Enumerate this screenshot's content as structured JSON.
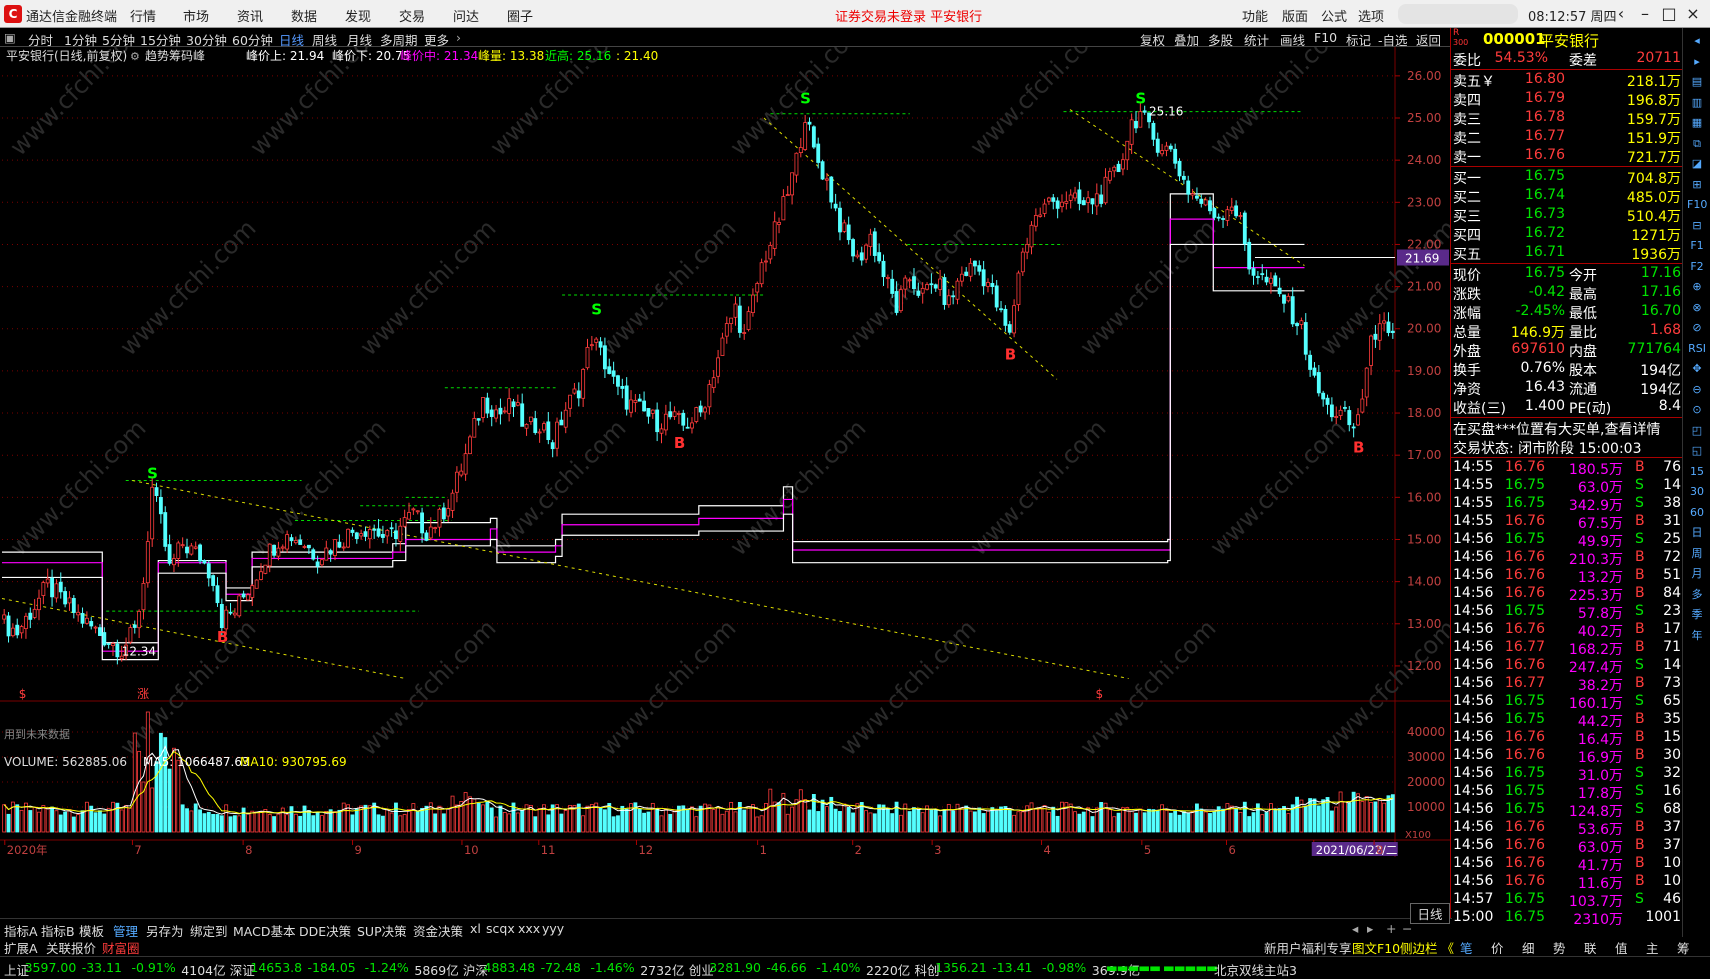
{
  "app": {
    "name": "通达信金融终端",
    "menu": [
      "行情",
      "市场",
      "资讯",
      "数据",
      "发现",
      "交易",
      "问达",
      "圈子"
    ],
    "status_notice": "证券交易未登录 平安银行",
    "right_menu": [
      "功能",
      "版面",
      "公式",
      "选项"
    ],
    "clock": "08:12:57 周四"
  },
  "period_bar": {
    "items": [
      "分时",
      "1分钟",
      "5分钟",
      "15分钟",
      "30分钟",
      "60分钟",
      "日线",
      "周线",
      "月线",
      "多周期",
      "更多"
    ],
    "active": "日线",
    "tools": [
      "复权",
      "叠加",
      "多股",
      "统计",
      "画线",
      "F10",
      "标记",
      "-自选",
      "返回"
    ]
  },
  "chart_header": {
    "title": "平安银行(日线,前复权)",
    "indicator": "趋势筹码峰",
    "items": [
      {
        "label": "峰价上: 21.94",
        "color": "#ffffff"
      },
      {
        "label": "峰价下: 20.75",
        "color": "#ffffff"
      },
      {
        "label": "峰价中: 21.34",
        "color": "#ff00ff"
      },
      {
        "label": "峰量: 13.38",
        "color": "#ffff00"
      },
      {
        "label": "近高: 25.16",
        "color": "#00ff00"
      },
      {
        "label": ": 21.40",
        "color": "#ffff00"
      }
    ]
  },
  "volume_header": {
    "label": "VOLUME: 562885.06",
    "ma5": "MA5: 1066487.63",
    "ma10": "MA10: 930795.69"
  },
  "chart_data": {
    "type": "candlestick",
    "colors": {
      "up": "#ff3c3c",
      "down": "#54ffff",
      "grid": "#7a0000",
      "ma5": "#ffffff",
      "ma10": "#ffff00",
      "peak": "#ff00ff",
      "band": "#ffffff"
    },
    "price_axis": {
      "ylim": [
        11.5,
        26.4
      ],
      "ticks": [
        "26.00",
        "25.00",
        "24.00",
        "23.00",
        "22.00",
        "21.00",
        "20.00",
        "19.00",
        "18.00",
        "17.00",
        "16.00",
        "15.00",
        "14.00",
        "13.00",
        "12.00"
      ]
    },
    "volume_axis": {
      "ylim": [
        0,
        50000
      ],
      "ticks": [
        "40000",
        "30000",
        "20000",
        "10000"
      ],
      "unit": "X100"
    },
    "x_axis": {
      "labels": [
        "2020年",
        "7",
        "8",
        "9",
        "10",
        "11",
        "12",
        "1",
        "2",
        "3",
        "4",
        "5",
        "6",
        "2021/06/22/二",
        "8"
      ]
    },
    "price_label": "21.69",
    "keypoints": [
      [
        0,
        13.0
      ],
      [
        3,
        12.8
      ],
      [
        10,
        13.9
      ],
      [
        14,
        13.5
      ],
      [
        19,
        13.0
      ],
      [
        24,
        12.6
      ],
      [
        27,
        12.4
      ],
      [
        30,
        12.8
      ],
      [
        32,
        14.0
      ],
      [
        34,
        16.2
      ],
      [
        36,
        15.4
      ],
      [
        38,
        14.3
      ],
      [
        41,
        14.9
      ],
      [
        45,
        14.6
      ],
      [
        48,
        14.1
      ],
      [
        50,
        13.1
      ],
      [
        53,
        13.3
      ],
      [
        57,
        14.0
      ],
      [
        60,
        14.6
      ],
      [
        63,
        15.0
      ],
      [
        66,
        15.1
      ],
      [
        69,
        14.9
      ],
      [
        72,
        14.6
      ],
      [
        76,
        14.9
      ],
      [
        80,
        15.2
      ],
      [
        84,
        15.3
      ],
      [
        88,
        15.0
      ],
      [
        91,
        15.3
      ],
      [
        94,
        15.6
      ],
      [
        97,
        15.2
      ],
      [
        100,
        15.5
      ],
      [
        103,
        16.1
      ],
      [
        106,
        17.0
      ],
      [
        110,
        18.3
      ],
      [
        114,
        18.0
      ],
      [
        117,
        18.2
      ],
      [
        120,
        17.6
      ],
      [
        123,
        17.8
      ],
      [
        126,
        17.3
      ],
      [
        129,
        18.1
      ],
      [
        132,
        18.6
      ],
      [
        135,
        19.8
      ],
      [
        138,
        19.2
      ],
      [
        141,
        18.5
      ],
      [
        144,
        18.2
      ],
      [
        147,
        18.0
      ],
      [
        150,
        17.8
      ],
      [
        153,
        17.9
      ],
      [
        156,
        17.7
      ],
      [
        160,
        18.0
      ],
      [
        163,
        19.0
      ],
      [
        166,
        20.0
      ],
      [
        168,
        20.5
      ],
      [
        170,
        19.8
      ],
      [
        174,
        21.5
      ],
      [
        177,
        22.3
      ],
      [
        180,
        23.2
      ],
      [
        182,
        24.0
      ],
      [
        184,
        25.1
      ],
      [
        186,
        24.2
      ],
      [
        189,
        23.5
      ],
      [
        192,
        22.5
      ],
      [
        196,
        21.6
      ],
      [
        199,
        22.2
      ],
      [
        202,
        21.3
      ],
      [
        205,
        20.5
      ],
      [
        208,
        21.2
      ],
      [
        211,
        20.8
      ],
      [
        214,
        21.1
      ],
      [
        217,
        20.6
      ],
      [
        220,
        21.3
      ],
      [
        223,
        21.5
      ],
      [
        226,
        21.1
      ],
      [
        229,
        20.3
      ],
      [
        231,
        19.8
      ],
      [
        233,
        21.4
      ],
      [
        236,
        22.5
      ],
      [
        240,
        23.0
      ],
      [
        244,
        23.1
      ],
      [
        248,
        22.9
      ],
      [
        252,
        23.2
      ],
      [
        256,
        23.8
      ],
      [
        259,
        24.9
      ],
      [
        261,
        25.1
      ],
      [
        264,
        24.5
      ],
      [
        268,
        24.2
      ],
      [
        272,
        23.3
      ],
      [
        276,
        22.9
      ],
      [
        279,
        22.7
      ],
      [
        282,
        23.0
      ],
      [
        284,
        22.5
      ],
      [
        286,
        21.5
      ],
      [
        290,
        21.1
      ],
      [
        294,
        20.7
      ],
      [
        298,
        20.0
      ],
      [
        301,
        18.7
      ],
      [
        304,
        18.1
      ],
      [
        308,
        17.9
      ],
      [
        310,
        17.6
      ],
      [
        312,
        18.4
      ],
      [
        314,
        19.6
      ],
      [
        316,
        20.3
      ],
      [
        318,
        19.7
      ],
      [
        320,
        19.8
      ]
    ],
    "dashed_resistance": [
      {
        "p": 13.3,
        "x1": 0.08,
        "x2": 0.32
      },
      {
        "p": 16.4,
        "x1": 0.095,
        "x2": 0.23
      },
      {
        "p": 15.45,
        "x1": 0.225,
        "x2": 0.345
      },
      {
        "p": 15.8,
        "x1": 0.275,
        "x2": 0.34
      },
      {
        "p": 16.0,
        "x1": 0.31,
        "x2": 0.34
      },
      {
        "p": 18.6,
        "x1": 0.34,
        "x2": 0.425
      },
      {
        "p": 20.8,
        "x1": 0.43,
        "x2": 0.585
      },
      {
        "p": 25.1,
        "x1": 0.59,
        "x2": 0.697
      },
      {
        "p": 22.0,
        "x1": 0.695,
        "x2": 0.815
      },
      {
        "p": 25.15,
        "x1": 0.815,
        "x2": 0.998
      }
    ],
    "trendlines": [
      [
        0.0,
        13.6,
        0.31,
        11.7
      ],
      [
        0.1,
        16.4,
        0.865,
        11.7
      ],
      [
        0.585,
        25.0,
        0.81,
        18.8
      ],
      [
        0.82,
        25.2,
        1.0,
        21.5
      ]
    ],
    "signals": [
      {
        "t": "S",
        "i": 34,
        "p": 16.3
      },
      {
        "t": "S",
        "i": 136,
        "p": 20.2
      },
      {
        "t": "S",
        "i": 184,
        "p": 25.2
      },
      {
        "t": "S",
        "i": 261,
        "p": 25.2
      },
      {
        "t": "B",
        "i": 50,
        "p": 12.9
      },
      {
        "t": "B",
        "i": 155,
        "p": 17.5
      },
      {
        "t": "B",
        "i": 231,
        "p": 19.6
      },
      {
        "t": "B",
        "i": 311,
        "p": 17.4
      }
    ],
    "peak_band": [
      [
        0.0,
        14.7,
        14.45,
        14.1
      ],
      [
        0.075,
        14.7,
        14.45,
        14.1
      ],
      [
        0.077,
        12.55,
        12.35,
        12.15
      ],
      [
        0.118,
        12.55,
        12.35,
        12.15
      ],
      [
        0.12,
        14.5,
        14.45,
        14.2
      ],
      [
        0.17,
        14.5,
        14.45,
        14.2
      ],
      [
        0.172,
        13.85,
        13.7,
        13.55
      ],
      [
        0.19,
        13.85,
        13.7,
        13.55
      ],
      [
        0.192,
        14.7,
        14.55,
        14.35
      ],
      [
        0.3,
        14.9,
        14.7,
        14.5
      ],
      [
        0.31,
        15.4,
        15.0,
        14.85
      ],
      [
        0.375,
        15.5,
        15.25,
        15.0
      ],
      [
        0.38,
        14.85,
        14.7,
        14.45
      ],
      [
        0.425,
        15.0,
        14.85,
        14.6
      ],
      [
        0.43,
        15.6,
        15.35,
        15.1
      ],
      [
        0.535,
        15.8,
        15.5,
        15.2
      ],
      [
        0.6,
        16.25,
        15.95,
        15.6
      ],
      [
        0.607,
        14.95,
        14.75,
        14.45
      ],
      [
        0.895,
        15.0,
        14.75,
        14.5
      ],
      [
        0.897,
        23.2,
        22.6,
        22.0
      ],
      [
        0.925,
        23.2,
        22.6,
        22.0
      ],
      [
        0.93,
        22.0,
        21.45,
        20.9
      ],
      [
        1.0,
        22.0,
        21.45,
        20.9
      ]
    ],
    "future_data_note": "用到未来数据",
    "markers": [
      {
        "t": "$",
        "x": 0.012,
        "color": "#ff3c3c"
      },
      {
        "t": "涨",
        "x": 0.097,
        "color": "#ff3c3c"
      },
      {
        "t": "$",
        "x": 0.785,
        "color": "#ff3c3c"
      }
    ],
    "price_tag": "25.16",
    "low_tag": "12.34"
  },
  "quote": {
    "code": "000001",
    "name": "平安银行",
    "r_label": "R",
    "num_label": "300",
    "weibi": {
      "label": "委比",
      "value": "54.53%",
      "label2": "委差",
      "value2": "20711"
    },
    "asks": [
      {
        "l": "卖五￥",
        "p": "16.80",
        "v": "218.1万"
      },
      {
        "l": "卖四",
        "p": "16.79",
        "v": "196.8万"
      },
      {
        "l": "卖三",
        "p": "16.78",
        "v": "159.7万"
      },
      {
        "l": "卖二",
        "p": "16.77",
        "v": "151.9万"
      },
      {
        "l": "卖一",
        "p": "16.76",
        "v": "721.7万"
      }
    ],
    "bids": [
      {
        "l": "买一",
        "p": "16.75",
        "v": "704.8万"
      },
      {
        "l": "买二",
        "p": "16.74",
        "v": "485.0万"
      },
      {
        "l": "买三",
        "p": "16.73",
        "v": "510.4万"
      },
      {
        "l": "买四",
        "p": "16.72",
        "v": "1271万"
      },
      {
        "l": "买五",
        "p": "16.71",
        "v": "1936万"
      }
    ],
    "stats": [
      [
        {
          "t": "现价",
          "c": "wht"
        },
        {
          "t": "16.75",
          "c": "grn"
        },
        {
          "t": "今开",
          "c": "wht"
        },
        {
          "t": "17.16",
          "c": "grn"
        }
      ],
      [
        {
          "t": "涨跌",
          "c": "wht"
        },
        {
          "t": "-0.42",
          "c": "grn"
        },
        {
          "t": "最高",
          "c": "wht"
        },
        {
          "t": "17.16",
          "c": "grn"
        }
      ],
      [
        {
          "t": "涨幅",
          "c": "wht"
        },
        {
          "t": "-2.45%",
          "c": "grn"
        },
        {
          "t": "最低",
          "c": "wht"
        },
        {
          "t": "16.70",
          "c": "grn"
        }
      ],
      [
        {
          "t": "总量",
          "c": "wht"
        },
        {
          "t": "146.9万",
          "c": "yel"
        },
        {
          "t": "量比",
          "c": "wht"
        },
        {
          "t": "1.68",
          "c": "red"
        }
      ],
      [
        {
          "t": "外盘",
          "c": "wht"
        },
        {
          "t": "697610",
          "c": "red"
        },
        {
          "t": "内盘",
          "c": "wht"
        },
        {
          "t": "771764",
          "c": "grn"
        }
      ],
      [
        {
          "t": "换手",
          "c": "wht"
        },
        {
          "t": "0.76%",
          "c": "wht"
        },
        {
          "t": "股本",
          "c": "wht"
        },
        {
          "t": "194亿",
          "c": "wht"
        }
      ],
      [
        {
          "t": "净资",
          "c": "wht"
        },
        {
          "t": "16.43",
          "c": "wht"
        },
        {
          "t": "流通",
          "c": "wht"
        },
        {
          "t": "194亿",
          "c": "wht"
        }
      ],
      [
        {
          "t": "收益(三)",
          "c": "wht"
        },
        {
          "t": "1.400",
          "c": "wht"
        },
        {
          "t": "PE(动)",
          "c": "wht"
        },
        {
          "t": "8.4",
          "c": "wht"
        }
      ]
    ],
    "notice": "在买盘***位置有大买单,查看详情",
    "trade_state": "交易状态: 闭市阶段 15:00:03",
    "ticks": [
      [
        "14:55",
        "16.76",
        "180.5万",
        "B",
        "76"
      ],
      [
        "14:55",
        "16.75",
        "63.0万",
        "S",
        "14"
      ],
      [
        "14:55",
        "16.75",
        "342.9万",
        "S",
        "38"
      ],
      [
        "14:55",
        "16.76",
        "67.5万",
        "B",
        "31"
      ],
      [
        "14:56",
        "16.75",
        "49.9万",
        "S",
        "25"
      ],
      [
        "14:56",
        "16.76",
        "210.3万",
        "B",
        "72"
      ],
      [
        "14:56",
        "16.76",
        "13.2万",
        "B",
        "51"
      ],
      [
        "14:56",
        "16.76",
        "225.3万",
        "B",
        "84"
      ],
      [
        "14:56",
        "16.75",
        "57.8万",
        "S",
        "23"
      ],
      [
        "14:56",
        "16.76",
        "40.2万",
        "B",
        "17"
      ],
      [
        "14:56",
        "16.77",
        "168.2万",
        "B",
        "71"
      ],
      [
        "14:56",
        "16.76",
        "247.4万",
        "S",
        "14"
      ],
      [
        "14:56",
        "16.77",
        "38.2万",
        "B",
        "73"
      ],
      [
        "14:56",
        "16.75",
        "160.1万",
        "S",
        "65"
      ],
      [
        "14:56",
        "16.75",
        "44.2万",
        "B",
        "35"
      ],
      [
        "14:56",
        "16.76",
        "16.4万",
        "B",
        "15"
      ],
      [
        "14:56",
        "16.76",
        "16.9万",
        "B",
        "30"
      ],
      [
        "14:56",
        "16.75",
        "31.0万",
        "S",
        "32"
      ],
      [
        "14:56",
        "16.75",
        "17.8万",
        "S",
        "16"
      ],
      [
        "14:56",
        "16.75",
        "124.8万",
        "S",
        "68"
      ],
      [
        "14:56",
        "16.76",
        "53.6万",
        "B",
        "37"
      ],
      [
        "14:56",
        "16.76",
        "63.0万",
        "B",
        "37"
      ],
      [
        "14:56",
        "16.76",
        "41.7万",
        "B",
        "10"
      ],
      [
        "14:56",
        "16.76",
        "11.6万",
        "B",
        "10"
      ],
      [
        "14:57",
        "16.75",
        "103.7万",
        "S",
        "46"
      ],
      [
        "15:00",
        "16.75",
        "2310万",
        "",
        "1001"
      ]
    ],
    "bottom_tabs": [
      "笔",
      "价",
      "细",
      "势",
      "联",
      "值",
      "主",
      "筹"
    ]
  },
  "icons": [
    "◂",
    "▸",
    "▤",
    "▥",
    "▦",
    "⧉",
    "◪",
    "⊞",
    "F10",
    "⊟",
    "F1",
    "F2",
    "⊕",
    "⊗",
    "⊘",
    "RSI",
    "✥",
    "⊖",
    "⊙",
    "◰",
    "◱",
    "15",
    "30",
    "60",
    "日",
    "周",
    "月",
    "多",
    "季",
    "年"
  ],
  "tabs": {
    "items": [
      "指标A",
      "指标B",
      "模板",
      "管理",
      "另存为",
      "绑定到",
      "MACD基本",
      "DDE决策",
      "SUP决策",
      "资金决策",
      "xl",
      "scqx",
      "xxx",
      "yyy"
    ],
    "selected": "管理",
    "right": "日线"
  },
  "tabs2": {
    "left": [
      "扩展A",
      "关联报价",
      "财富圈"
    ],
    "right": [
      "新用户福利专享",
      "图文F10",
      "侧边栏 《"
    ]
  },
  "index_bar": [
    {
      "name": "上证",
      "val": "3597.00",
      "chg": "-33.11",
      "pct": "-0.91%",
      "amt": "4104亿"
    },
    {
      "name": "深证",
      "val": "14653.8",
      "chg": "-184.05",
      "pct": "-1.24%",
      "amt": "5869亿"
    },
    {
      "name": "沪深",
      "val": "4883.48",
      "chg": "-72.48",
      "pct": "-1.46%",
      "amt": "2732亿"
    },
    {
      "name": "创业",
      "val": "3281.90",
      "chg": "-46.66",
      "pct": "-1.40%",
      "amt": "2220亿"
    },
    {
      "name": "科创",
      "val": "1356.21",
      "chg": "-13.41",
      "pct": "-0.98%",
      "amt": "369.9亿"
    }
  ],
  "server": "北京双线主站3",
  "watermark": "www.cfchi.com"
}
